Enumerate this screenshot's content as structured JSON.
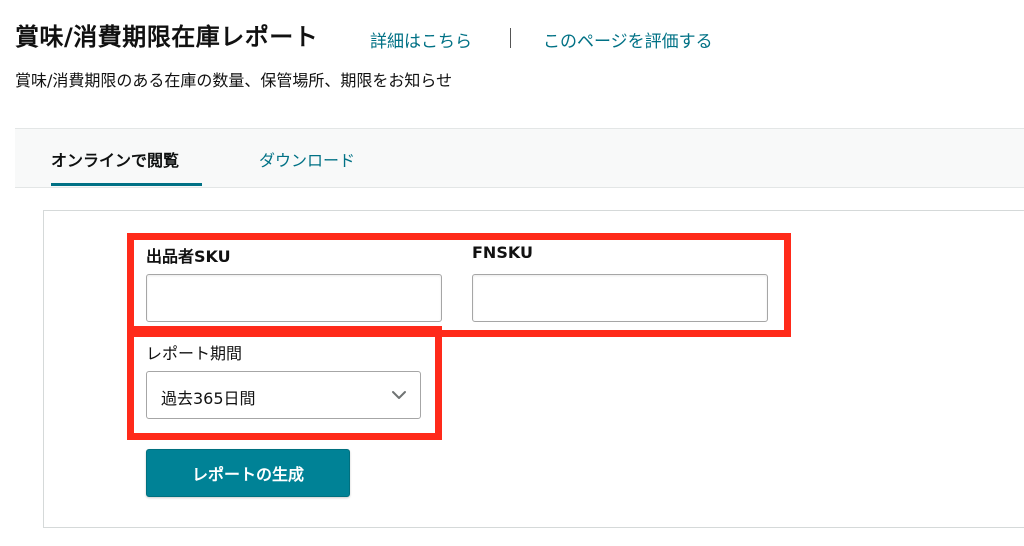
{
  "header": {
    "title": "賞味/消費期限在庫レポート",
    "details_link": "詳細はこちら",
    "rate_link": "このページを評価する",
    "subtitle": "賞味/消費期限のある在庫の数量、保管場所、期限をお知らせ"
  },
  "tabs": [
    {
      "label": "オンラインで閲覧",
      "active": true
    },
    {
      "label": "ダウンロード",
      "active": false
    }
  ],
  "form": {
    "seller_sku": {
      "label": "出品者SKU",
      "value": ""
    },
    "fnsku": {
      "label": "FNSKU",
      "value": ""
    },
    "report_period": {
      "label": "レポート期間",
      "selected": "過去365日間"
    },
    "generate_button": "レポートの生成"
  },
  "icons": {
    "dropdown": "chevron-down-icon"
  },
  "colors": {
    "link": "#007185",
    "primary_button": "#008296",
    "highlight": "#ff2a1a"
  }
}
